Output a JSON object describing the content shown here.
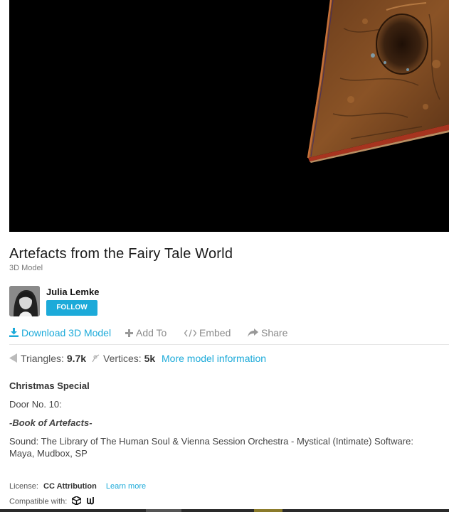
{
  "model": {
    "title": "Artefacts from the Fairy Tale World",
    "type_label": "3D Model"
  },
  "author": {
    "name": "Julia Lemke",
    "follow_label": "FOLLOW"
  },
  "actions": {
    "download_label": "Download 3D Model",
    "add_label": "Add To",
    "embed_label": "Embed",
    "share_label": "Share"
  },
  "stats": {
    "triangles_label": "Triangles:",
    "triangles_value": "9.7k",
    "vertices_label": "Vertices:",
    "vertices_value": "5k",
    "more_info_label": "More model information"
  },
  "description": {
    "heading": "Christmas Special",
    "line1": "Door No. 10:",
    "line2": "-Book of Artefacts-",
    "line3": "Sound: The Library of The Human Soul & Vienna Session Orchestra - Mystical (Intimate) Software:",
    "line4": "Maya, Mudbox, SP"
  },
  "license": {
    "label": "License:",
    "name": "CC Attribution",
    "learn_more": "Learn more"
  },
  "compat": {
    "label": "Compatible with:",
    "icons": [
      "unity-icon",
      "unreal-icon"
    ]
  },
  "colors": {
    "accent": "#1caad9",
    "viewer_bg": "#000000"
  }
}
